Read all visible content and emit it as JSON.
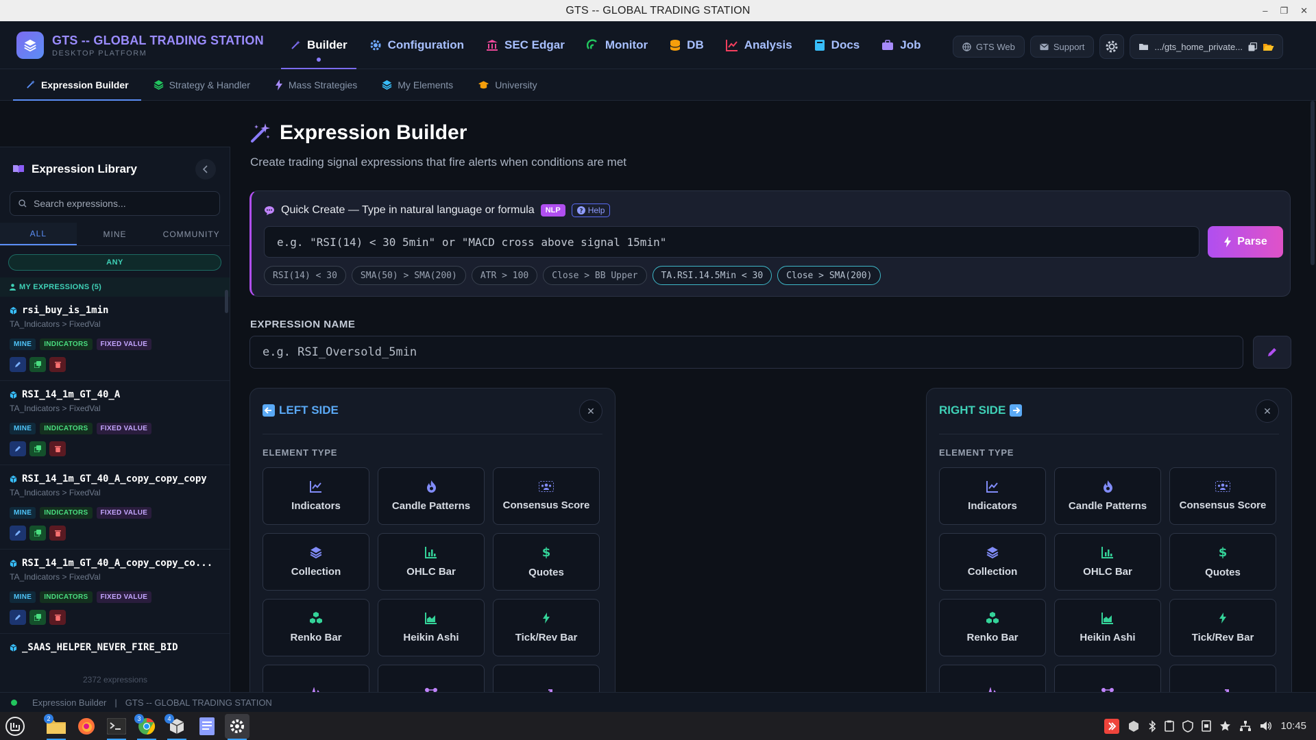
{
  "window": {
    "title": "GTS -- GLOBAL TRADING STATION"
  },
  "brand": {
    "name": "GTS -- GLOBAL TRADING STATION",
    "sub": "DESKTOP PLATFORM"
  },
  "nav": {
    "items": [
      {
        "label": "Builder",
        "icon": "magic-wand-icon",
        "color": "#7c6cf0"
      },
      {
        "label": "Configuration",
        "icon": "gear-icon",
        "color": "#6ea8fe"
      },
      {
        "label": "SEC Edgar",
        "icon": "bank-icon",
        "color": "#ec4899"
      },
      {
        "label": "Monitor",
        "icon": "monitor-wave-icon",
        "color": "#22c55e"
      },
      {
        "label": "DB",
        "icon": "database-icon",
        "color": "#f59e0b"
      },
      {
        "label": "Analysis",
        "icon": "chart-line-icon",
        "color": "#f43f5e"
      },
      {
        "label": "Docs",
        "icon": "book-icon",
        "color": "#38bdf8"
      },
      {
        "label": "Job",
        "icon": "briefcase-icon",
        "color": "#a78bfa"
      }
    ],
    "gts_web": "GTS Web",
    "support": "Support",
    "path": ".../gts_home_private..."
  },
  "subnav": {
    "items": [
      {
        "label": "Expression Builder",
        "icon": "magic-wand-icon",
        "color": "#5b8ef5"
      },
      {
        "label": "Strategy & Handler",
        "icon": "layers-icon",
        "color": "#22c55e"
      },
      {
        "label": "Mass Strategies",
        "icon": "bolt-icon",
        "color": "#a78bfa"
      },
      {
        "label": "My Elements",
        "icon": "layers-icon",
        "color": "#38bdf8"
      },
      {
        "label": "University",
        "icon": "graduation-cap-icon",
        "color": "#f59e0b"
      }
    ]
  },
  "sidebar": {
    "title": "Expression Library",
    "search_placeholder": "Search expressions...",
    "tabs": [
      "ALL",
      "MINE",
      "COMMUNITY"
    ],
    "filter": "ANY",
    "section": "MY EXPRESSIONS (5)",
    "items": [
      {
        "name": "rsi_buy_is_1min",
        "path": "TA_Indicators > FixedVal",
        "tags": [
          "MINE",
          "INDICATORS",
          "FIXED VALUE"
        ]
      },
      {
        "name": "RSI_14_1m_GT_40_A",
        "path": "TA_Indicators > FixedVal",
        "tags": [
          "MINE",
          "INDICATORS",
          "FIXED VALUE"
        ]
      },
      {
        "name": "RSI_14_1m_GT_40_A_copy_copy_copy",
        "path": "TA_Indicators > FixedVal",
        "tags": [
          "MINE",
          "INDICATORS",
          "FIXED VALUE"
        ]
      },
      {
        "name": "RSI_14_1m_GT_40_A_copy_copy_co...",
        "path": "TA_Indicators > FixedVal",
        "tags": [
          "MINE",
          "INDICATORS",
          "FIXED VALUE"
        ]
      },
      {
        "name": "_SAAS_HELPER_NEVER_FIRE_BID",
        "path": "",
        "tags": []
      }
    ],
    "count": "2372 expressions"
  },
  "main": {
    "title": "Expression Builder",
    "subtitle": "Create trading signal expressions that fire alerts when conditions are met",
    "quick_create": {
      "label": "Quick Create — Type in natural language or formula",
      "nlp_badge": "NLP",
      "help": "Help",
      "placeholder": "e.g. \"RSI(14) < 30 5min\" or \"MACD cross above signal 15min\"",
      "parse": "Parse",
      "chips": [
        "RSI(14) < 30",
        "SMA(50) > SMA(200)",
        "ATR > 100",
        "Close > BB Upper",
        "TA.RSI.14.5Min < 30",
        "Close > SMA(200)"
      ]
    },
    "expression_name": {
      "label": "EXPRESSION NAME",
      "placeholder": "e.g. RSI_Oversold_5min"
    },
    "left_side": {
      "title": "LEFT SIDE",
      "element_type": "ELEMENT TYPE"
    },
    "right_side": {
      "title": "RIGHT SIDE",
      "element_type": "ELEMENT TYPE"
    },
    "element_types": [
      {
        "label": "Indicators",
        "icon": "chart-line-icon",
        "color": "#818cf8"
      },
      {
        "label": "Candle Patterns",
        "icon": "fire-icon",
        "color": "#818cf8"
      },
      {
        "label": "Consensus Score",
        "icon": "users-icon",
        "color": "#818cf8"
      },
      {
        "label": "Collection",
        "icon": "layers-icon",
        "color": "#818cf8"
      },
      {
        "label": "OHLC Bar",
        "icon": "bar-chart-icon",
        "color": "#34d399"
      },
      {
        "label": "Quotes",
        "icon": "dollar-icon",
        "color": "#34d399"
      },
      {
        "label": "Renko Bar",
        "icon": "cubes-icon",
        "color": "#34d399"
      },
      {
        "label": "Heikin Ashi",
        "icon": "area-chart-icon",
        "color": "#34d399"
      },
      {
        "label": "Tick/Rev Bar",
        "icon": "bolt-icon",
        "color": "#34d399"
      },
      {
        "label": "",
        "icon": "pulse-icon",
        "color": "#c084fc"
      },
      {
        "label": "",
        "icon": "nodes-icon",
        "color": "#c084fc"
      },
      {
        "label": "",
        "icon": "trend-up-icon",
        "color": "#c084fc"
      }
    ]
  },
  "statusbar": {
    "left": "Expression Builder",
    "sep": "|",
    "right": "GTS -- GLOBAL TRADING STATION"
  },
  "taskbar": {
    "time": "10:45",
    "badges": [
      "2",
      "3",
      "4"
    ]
  }
}
